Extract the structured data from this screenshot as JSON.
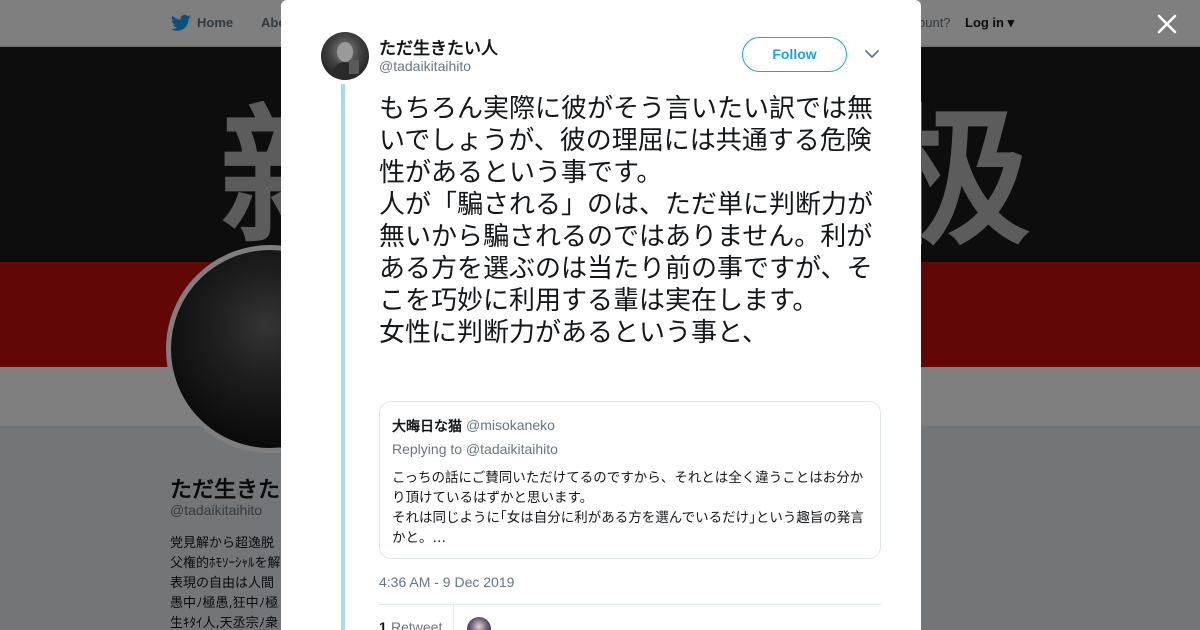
{
  "nav": {
    "home_label": "Home",
    "about_label": "Abo",
    "account_prompt": "ccount?",
    "login_label": "Log in"
  },
  "banner": {
    "kanji_left": "新",
    "kanji_right": "极"
  },
  "profile": {
    "name": "ただ生きた",
    "handle": "@tadaikitaihito",
    "bio_lines": [
      "党見解から超逸脱",
      "父権的ﾎﾓｿｰｼｬﾙを解",
      "表現の自由は人間",
      "愚中ﾉ極愚,狂中ﾉ極",
      "生ｷﾀｲ人,天丞宗ﾉ衆"
    ]
  },
  "tweet": {
    "author_name": "ただ生きたい人",
    "author_handle": "@tadaikitaihito",
    "follow_label": "Follow",
    "text": "もちろん実際に彼がそう言いたい訳では無いでしょうが、彼の理屈には共通する危険性があるという事です。\n人が「騙される」のは、ただ単に判断力が無いから騙されるのではありません。利がある方を選ぶのは当たり前の事ですが、そこを巧妙に利用する輩は実在します。\n女性に判断力があるという事と、",
    "timestamp": "4:36 AM - 9 Dec 2019",
    "retweet_count": "1",
    "retweet_label": "Retweet"
  },
  "quote": {
    "name": "大晦日な猫",
    "handle": "@misokaneko",
    "replying_to": "Replying to @tadaikitaihito",
    "text": "こっちの話にご賛同いただけてるのですから、それとは全く違うことはお分かり頂けているはずかと思います。\nそれは同じように｢女は自分に利がある方を選んでいるだけ｣という趣旨の発言かと。…"
  },
  "colors": {
    "accent": "#1da1f2",
    "thread_line": "#a5d9f5",
    "banner_red": "#c40c0c",
    "text_primary": "#14171a",
    "text_secondary": "#657786"
  },
  "icons": {
    "nav": "twitter-bird-icon",
    "close": "close-icon",
    "menu": "chevron-down-icon"
  }
}
